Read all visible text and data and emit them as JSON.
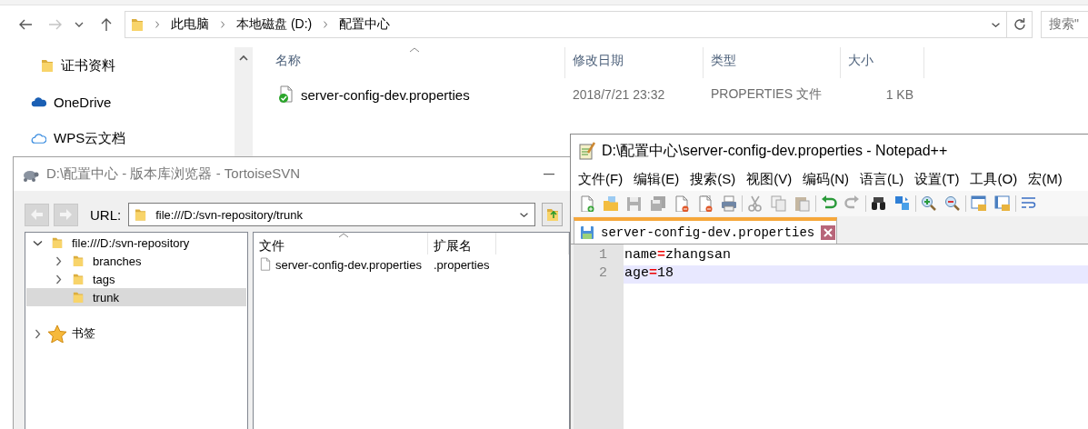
{
  "explorer": {
    "nav": [
      {
        "kind": "back",
        "disabled": false
      },
      {
        "kind": "forward",
        "disabled": true
      },
      {
        "kind": "recent",
        "disabled": false
      },
      {
        "kind": "up",
        "disabled": false
      }
    ],
    "breadcrumb": [
      "此电脑",
      "本地磁盘 (D:)",
      "配置中心"
    ],
    "search": {
      "placeholder": "搜索\""
    },
    "sidebar": {
      "items": [
        {
          "label": "证书资料",
          "kind": "folder"
        },
        {
          "label": "OneDrive",
          "kind": "onedrive"
        },
        {
          "label": "WPS云文档",
          "kind": "cloud"
        }
      ]
    },
    "table": {
      "columns": [
        "名称",
        "修改日期",
        "类型",
        "大小"
      ],
      "rows": [
        {
          "cells": [
            "server-config-dev.properties",
            "2018/7/21 23:32",
            "PROPERTIES 文件",
            "1 KB"
          ]
        }
      ]
    }
  },
  "svn_window": {
    "title": "D:\\配置中心 - 版本库浏览器 - TortoiseSVN",
    "nav": [
      {
        "kind": "back",
        "disabled": true
      },
      {
        "kind": "forward",
        "disabled": true
      }
    ],
    "url_label": "URL:",
    "url": "file:///D:/svn-repository/trunk",
    "tree": [
      {
        "label": "file:///D:/svn-repository",
        "kind": "folder",
        "expanded": true,
        "selected": false,
        "children": [
          {
            "label": "branches",
            "kind": "folder",
            "expanded": false,
            "selected": false
          },
          {
            "label": "tags",
            "kind": "folder",
            "expanded": false,
            "selected": false
          },
          {
            "label": "trunk",
            "kind": "folder",
            "selected": true
          }
        ]
      },
      {
        "label": "书签",
        "kind": "bookmarks",
        "expanded": false,
        "selected": false
      }
    ],
    "file_list": {
      "columns": [
        "文件",
        "扩展名"
      ],
      "rows": [
        [
          "server-config-dev.properties",
          ".properties"
        ]
      ]
    }
  },
  "notepad": {
    "title": "D:\\配置中心\\server-config-dev.properties - Notepad++",
    "menu": [
      "文件(F)",
      "编辑(E)",
      "搜索(S)",
      "视图(V)",
      "编码(N)",
      "语言(L)",
      "设置(T)",
      "工具(O)",
      "宏(M)"
    ],
    "toolbar": [
      [
        {
          "kind": "new",
          "disabled": false
        },
        {
          "kind": "open",
          "disabled": false
        },
        {
          "kind": "save",
          "disabled": true
        },
        {
          "kind": "save_all",
          "disabled": true
        },
        {
          "kind": "close",
          "disabled": false
        },
        {
          "kind": "close_all",
          "disabled": false
        },
        {
          "kind": "print",
          "disabled": false
        }
      ],
      [
        {
          "kind": "cut",
          "disabled": true
        },
        {
          "kind": "copy",
          "disabled": true
        },
        {
          "kind": "paste",
          "disabled": true
        }
      ],
      [
        {
          "kind": "undo",
          "disabled": false
        },
        {
          "kind": "redo",
          "disabled": true
        }
      ],
      [
        {
          "kind": "find",
          "disabled": false
        },
        {
          "kind": "replace",
          "disabled": false
        }
      ],
      [
        {
          "kind": "zoom_in",
          "disabled": false
        },
        {
          "kind": "zoom_out",
          "disabled": false
        }
      ],
      [
        {
          "kind": "sync_v",
          "disabled": false
        },
        {
          "kind": "sync_h",
          "disabled": false
        }
      ],
      [
        {
          "kind": "wrap",
          "disabled": false
        }
      ]
    ],
    "tabs": [
      {
        "label": "server-config-dev.properties",
        "selected": true
      }
    ],
    "lines": [
      {
        "number": "1",
        "key": "name",
        "operator": "=",
        "value": "zhangsan",
        "current": false
      },
      {
        "number": "2",
        "key": "age",
        "operator": "=",
        "value": "18",
        "current": true
      }
    ]
  }
}
